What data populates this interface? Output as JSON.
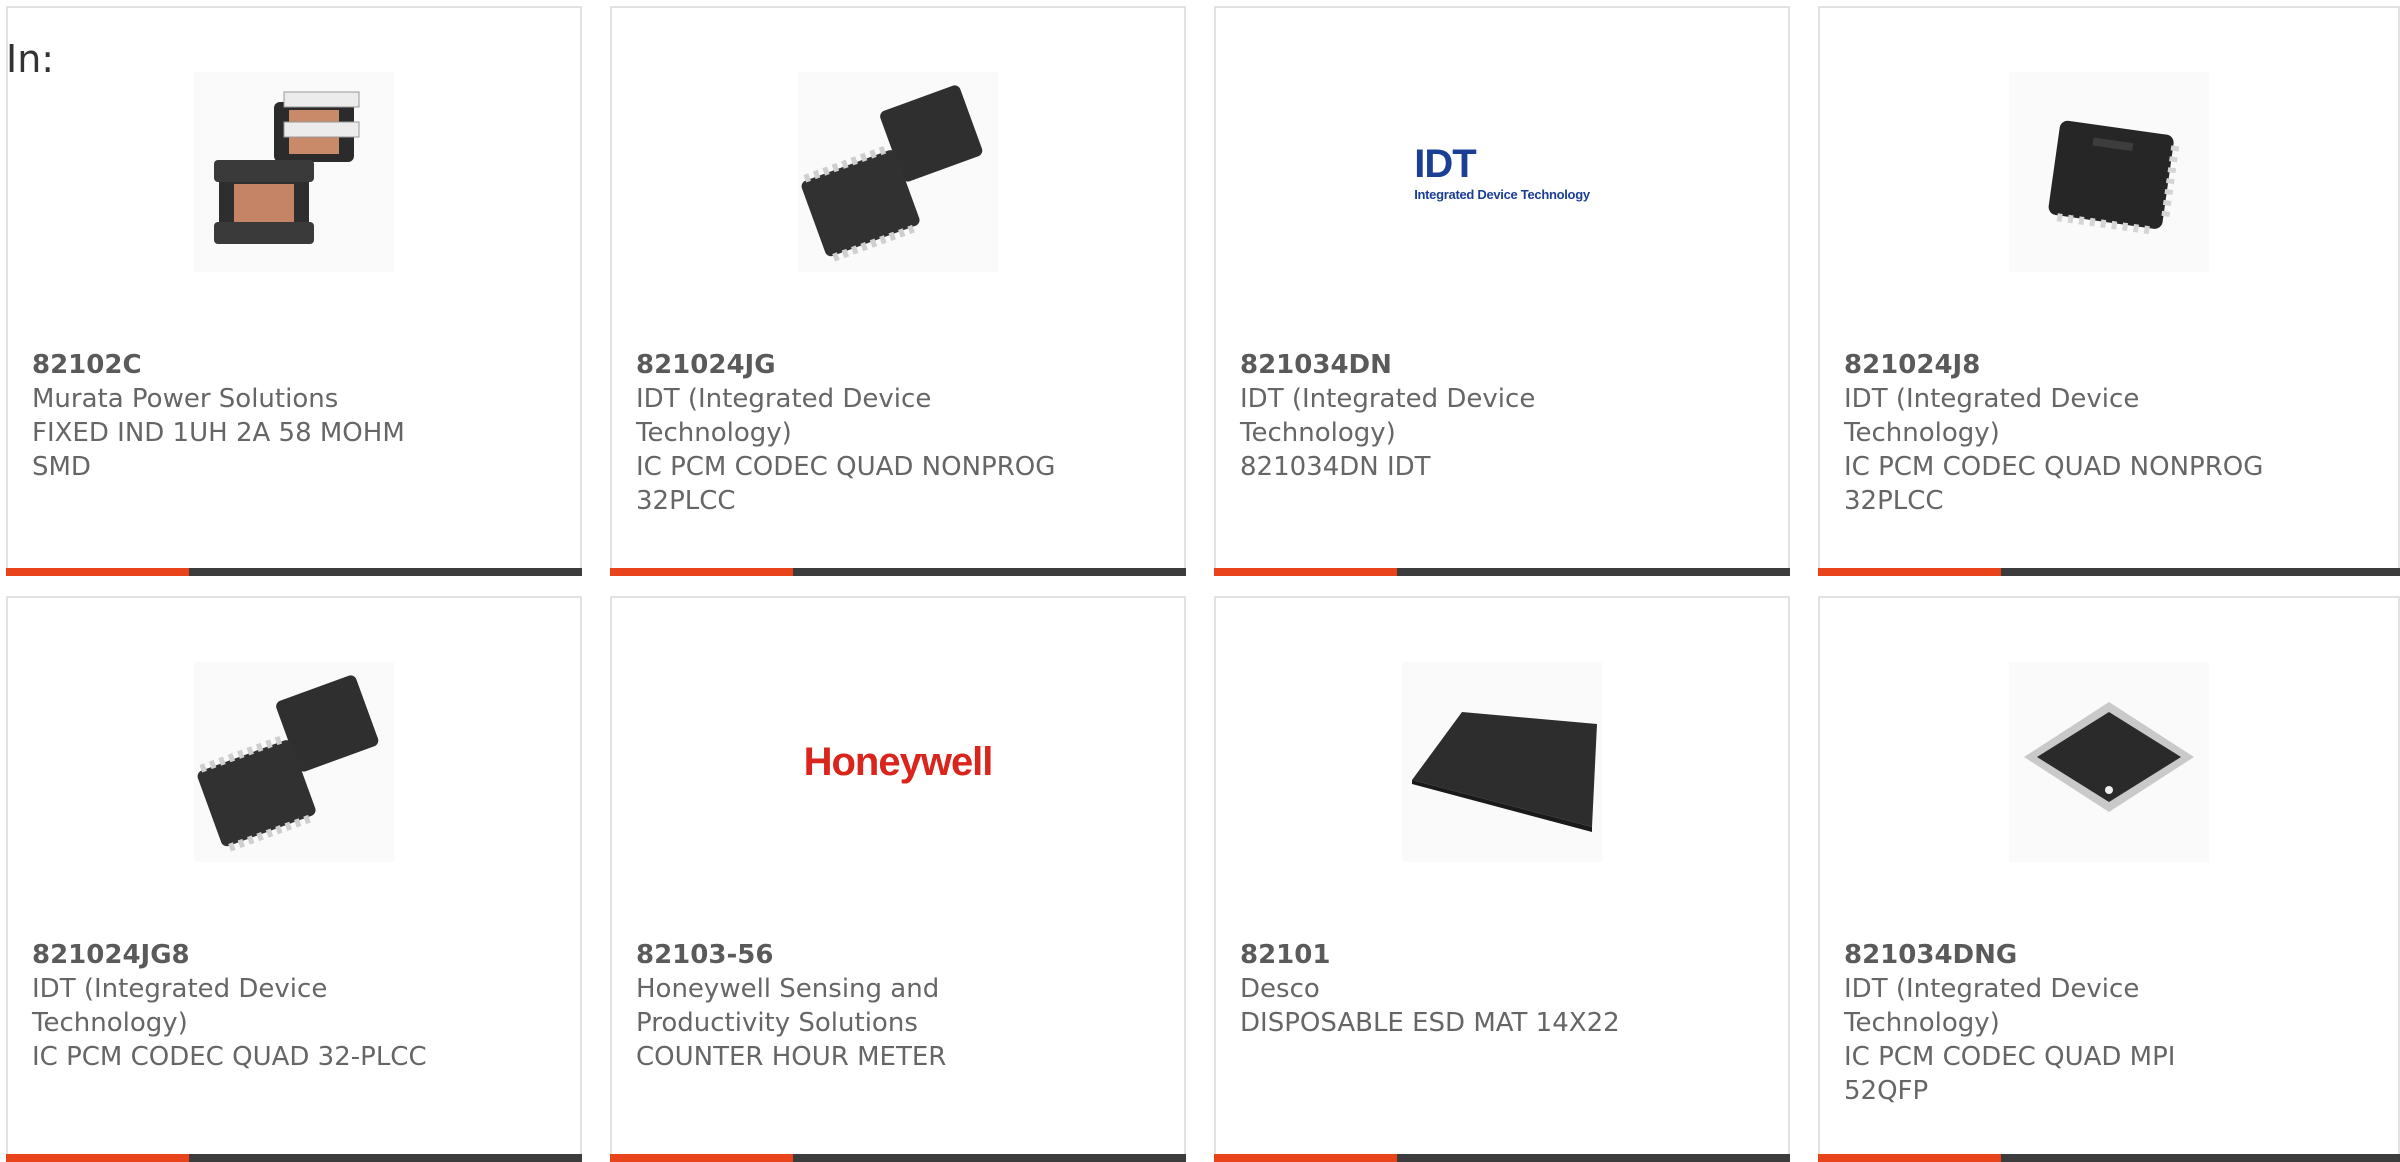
{
  "filter": {
    "label": "In:"
  },
  "products": [
    {
      "part_number": "82102C",
      "manufacturer": "Murata Power Solutions",
      "description": "FIXED IND 1UH 2A 58 MOHM SMD",
      "image": "inductor-icon"
    },
    {
      "part_number": "821024JG",
      "manufacturer": "IDT (Integrated Device Technology)",
      "description": "IC PCM CODEC QUAD NONPROG 32PLCC",
      "image": "plcc-chip-icon"
    },
    {
      "part_number": "821034DN",
      "manufacturer": "IDT (Integrated Device Technology)",
      "description": "821034DN IDT",
      "image": "idt-logo",
      "logo_text": "IDT",
      "logo_subtext": "Integrated Device Technology"
    },
    {
      "part_number": "821024J8",
      "manufacturer": "IDT (Integrated Device Technology)",
      "description": "IC PCM CODEC QUAD NONPROG 32PLCC",
      "image": "plcc-chip-icon"
    },
    {
      "part_number": "821024JG8",
      "manufacturer": "IDT (Integrated Device Technology)",
      "description": "IC PCM CODEC QUAD 32-PLCC",
      "image": "plcc-chip-icon"
    },
    {
      "part_number": "82103-56",
      "manufacturer": "Honeywell Sensing and Productivity Solutions",
      "description": "COUNTER HOUR METER",
      "image": "honeywell-logo",
      "logo_text": "Honeywell"
    },
    {
      "part_number": "82101",
      "manufacturer": "Desco",
      "description": "DISPOSABLE ESD MAT 14X22",
      "image": "esd-mat-icon"
    },
    {
      "part_number": "821034DNG",
      "manufacturer": "IDT (Integrated Device Technology)",
      "description": "IC PCM CODEC QUAD MPI 52QFP",
      "image": "qfp-chip-icon"
    }
  ],
  "colors": {
    "accent": "#e8431a",
    "bar": "#3c3c3c",
    "idt_blue": "#1b3f94",
    "honeywell_red": "#d9251c"
  }
}
